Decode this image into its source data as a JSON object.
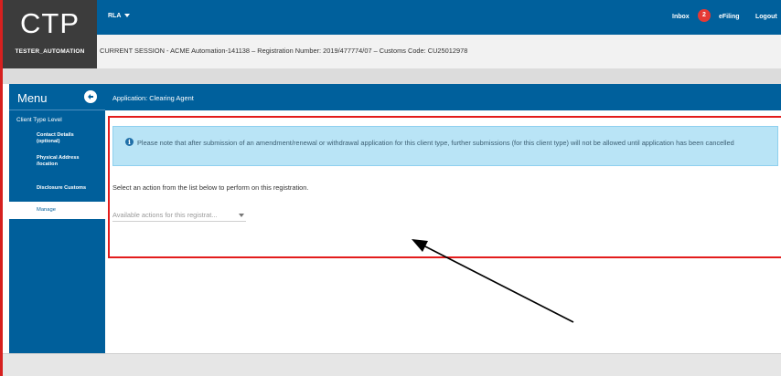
{
  "logo": {
    "title": "CTP",
    "user": "TESTER_AUTOMATION"
  },
  "topbar": {
    "user_menu": "RLA",
    "inbox_label": "Inbox",
    "inbox_count": "2",
    "efiling_label": "eFiling",
    "logout_label": "Logout"
  },
  "session": {
    "text": "CURRENT SESSION - ACME Automation-141138 – Registration Number: 2019/477774/07 – Customs Code: CU25012978"
  },
  "sidebar": {
    "title": "Menu",
    "section": "Client Type Level",
    "items": [
      {
        "label": "Contact Details (optional)"
      },
      {
        "label": "Physical Address /location"
      },
      {
        "label": "Disclosure Customs"
      },
      {
        "label": "Manage"
      }
    ]
  },
  "main": {
    "heading": "Application: Clearing Agent",
    "alert": "Please note that after submission of an amendment/renewal or withdrawal application for this client type, further submissions (for this client type) will not be allowed until application has been cancelled",
    "instruction": "Select an action from the list below to perform on this registration.",
    "dropdown_placeholder": "Available actions for this registrat..."
  },
  "colors": {
    "brand_blue": "#00609c",
    "logo_bg": "#3c3c3c",
    "alert_bg": "#b9e4f6",
    "highlight_red": "#e31c1c",
    "badge_red": "#e53935"
  }
}
